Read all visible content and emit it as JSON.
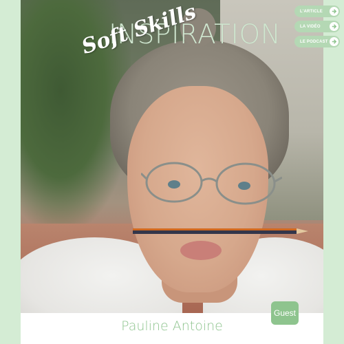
{
  "header": {
    "title": "INSPIRATION",
    "subtitle": "Soft Skills"
  },
  "nav": {
    "items": [
      {
        "label": "L'ARTICLE",
        "icon": "arrow-right-icon"
      },
      {
        "label": "LA VIDÉO",
        "icon": "arrow-right-icon"
      },
      {
        "label": "LE PODCAST",
        "icon": "arrow-right-icon"
      }
    ]
  },
  "guest": {
    "name": "Pauline Antoine",
    "badge": "Guest"
  },
  "colors": {
    "accent": "#8ec48e",
    "nav_button": "#b4d8b4",
    "frame": "#d4ecd4"
  }
}
